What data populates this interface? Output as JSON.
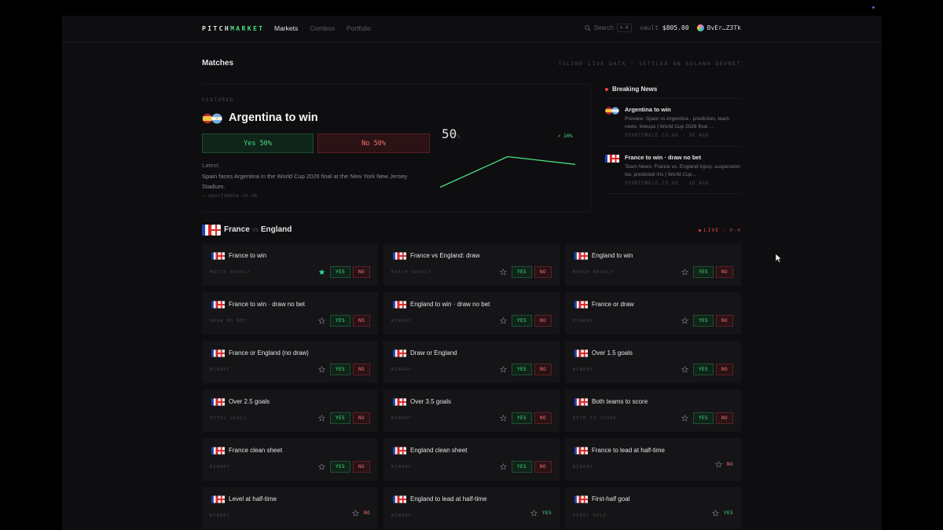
{
  "header": {
    "logo_a": "PITCH",
    "logo_b": "MARKET",
    "nav": [
      "Markets",
      "Combos",
      "Portfolio"
    ],
    "search_label": "Search",
    "search_shortcut": "⌘ K",
    "vault_label": "vault",
    "vault_value": "$805.00",
    "wallet": "BvEr…Z3Tk"
  },
  "page": {
    "title": "Matches",
    "subtitle": "TXLINE LIVE DATA · SETTLED ON SOLANA DEVNET"
  },
  "featured": {
    "label": "FEATURED",
    "title": "Argentina to win",
    "yes_label": "Yes 50%",
    "no_label": "No 50%",
    "latest_label": "Latest:",
    "latest_text": "Spain faces Argentina in the World Cup 2026 final at the New York New Jersey Stadium.",
    "latest_source": "— sportsmole.co.uk",
    "percent": "50",
    "percent_unit": "%",
    "delta": "↗ 10%"
  },
  "chart_data": {
    "type": "line",
    "x": [
      0,
      1,
      2
    ],
    "values": [
      40,
      60,
      55
    ],
    "ylim": [
      30,
      70
    ],
    "color": "#4ade80"
  },
  "news": {
    "title": "Breaking News",
    "items": [
      {
        "headline": "Argentina to win",
        "body": "Preview: Spain vs Argentina - prediction, team news, lineups | World Cup 2026 final ...",
        "source": "SPORTSMOLE.CO.UK · 3D AGO"
      },
      {
        "headline": "France to win · draw no bet",
        "body": "Team News: France vs. England injury, suspension list, predicted XIs | World Cup...",
        "source": "SPORTSMOLE.CO.UK · 1D AGO"
      }
    ]
  },
  "match": {
    "home": "France",
    "vs": "vs",
    "away": "England",
    "live_label": "LIVE",
    "score": "0-4"
  },
  "markets": [
    {
      "title": "France to win",
      "type": "MATCH RESULT",
      "starred": true,
      "mode": "both"
    },
    {
      "title": "France vs England: draw",
      "type": "MATCH RESULT",
      "starred": false,
      "mode": "both"
    },
    {
      "title": "England to win",
      "type": "MATCH RESULT",
      "starred": false,
      "mode": "both"
    },
    {
      "title": "France to win · draw no bet",
      "type": "DRAW NO BET",
      "starred": false,
      "mode": "both"
    },
    {
      "title": "England to win · draw no bet",
      "type": "BINARY",
      "starred": false,
      "mode": "both"
    },
    {
      "title": "France or draw",
      "type": "BINARY",
      "starred": false,
      "mode": "both"
    },
    {
      "title": "France or England (no draw)",
      "type": "BINARY",
      "starred": false,
      "mode": "both"
    },
    {
      "title": "Draw or England",
      "type": "BINARY",
      "starred": false,
      "mode": "both"
    },
    {
      "title": "Over 1.5 goals",
      "type": "BINARY",
      "starred": false,
      "mode": "both"
    },
    {
      "title": "Over 2.5 goals",
      "type": "TOTAL GOALS",
      "starred": false,
      "mode": "both"
    },
    {
      "title": "Over 3.5 goals",
      "type": "BINARY",
      "starred": false,
      "mode": "both"
    },
    {
      "title": "Both teams to score",
      "type": "BOTH TO SCORE",
      "starred": false,
      "mode": "both"
    },
    {
      "title": "France clean sheet",
      "type": "BINARY",
      "starred": false,
      "mode": "both"
    },
    {
      "title": "England clean sheet",
      "type": "BINARY",
      "starred": false,
      "mode": "both"
    },
    {
      "title": "France to lead at half-time",
      "type": "BINARY",
      "starred": false,
      "mode": "no"
    },
    {
      "title": "Level at half-time",
      "type": "BINARY",
      "starred": false,
      "mode": "no"
    },
    {
      "title": "England to lead at half-time",
      "type": "BINARY",
      "starred": false,
      "mode": "yes"
    },
    {
      "title": "First-half goal",
      "type": "FIRST HALF",
      "starred": false,
      "mode": "yes"
    }
  ],
  "labels": {
    "yes": "YES",
    "no": "NO"
  },
  "colors": {
    "accent": "#4ade80",
    "danger": "#f87171",
    "background": "#0e0e10",
    "card": "#151517"
  }
}
